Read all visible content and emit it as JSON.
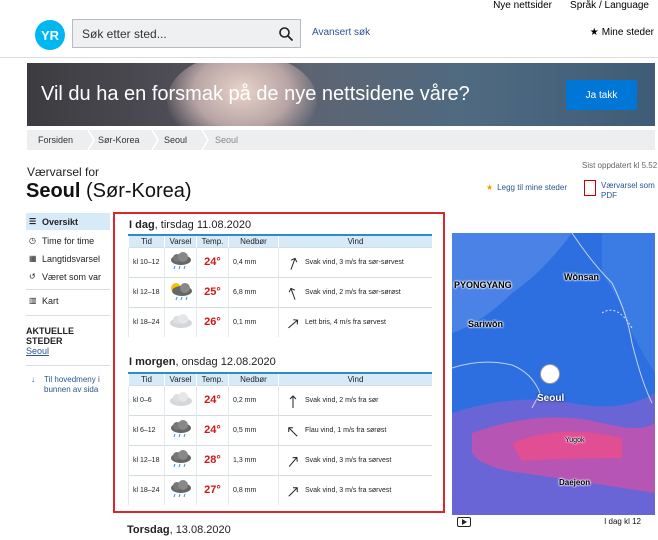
{
  "topnav": {
    "new_sites": "Nye nettsider",
    "language": "Språk / Language"
  },
  "header": {
    "logo": "YR",
    "search_placeholder": "Søk etter sted...",
    "advanced_search": "Avansert søk",
    "my_places": "Mine steder"
  },
  "banner": {
    "text": "Vil du ha en forsmak på de nye nettsidene våre?",
    "button": "Ja takk"
  },
  "breadcrumb": [
    "Forsiden",
    "Sør-Korea",
    "Seoul",
    "Seoul"
  ],
  "page": {
    "forecast_for": "Værvarsel for",
    "place": "Seoul",
    "country": "(Sør-Korea)",
    "updated": "Sist oppdatert kl 5.52",
    "add_favorite": "Legg til mine steder",
    "pdf_line1": "Værvarsel som",
    "pdf_line2": "PDF"
  },
  "sidebar": {
    "items": [
      {
        "label": "Oversikt",
        "icon": "list-icon"
      },
      {
        "label": "Time for time",
        "icon": "clock-icon"
      },
      {
        "label": "Langtidsvarsel",
        "icon": "calendar-icon"
      },
      {
        "label": "Været som var",
        "icon": "history-icon"
      },
      {
        "label": "Kart",
        "icon": "map-icon"
      }
    ],
    "current_heading": "AKTUELLE STEDER",
    "current_place": "Seoul",
    "back_to_menu_line1": "Til hovedmeny i",
    "back_to_menu_line2": "bunnen av sida"
  },
  "table_headers": {
    "time": "Tid",
    "symbol": "Varsel",
    "temp": "Temp.",
    "precip": "Nedbør",
    "wind": "Vind"
  },
  "days": [
    {
      "day": "I dag",
      "date": ", tirsdag 11.08.2020",
      "rows": [
        {
          "time": "kl 10–12",
          "icon": "rain-cloud-icon",
          "temp": "24°",
          "precip": "0,4 mm",
          "wind": "Svak vind, 3 m/s fra sør-sørvest",
          "wind_dir": 200
        },
        {
          "time": "kl 12–18",
          "icon": "sun-rain-cloud-icon",
          "temp": "25°",
          "precip": "6,8 mm",
          "wind": "Svak vind, 2 m/s fra sør-sørøst",
          "wind_dir": 160
        },
        {
          "time": "kl 18–24",
          "icon": "cloud-icon",
          "temp": "26°",
          "precip": "0,1 mm",
          "wind": "Lett bris, 4 m/s fra sørvest",
          "wind_dir": 230
        }
      ]
    },
    {
      "day": "I morgen",
      "date": ", onsdag 12.08.2020",
      "rows": [
        {
          "time": "kl 0–6",
          "icon": "cloud-icon",
          "temp": "24°",
          "precip": "0,2 mm",
          "wind": "Svak vind, 2 m/s fra sør",
          "wind_dir": 180
        },
        {
          "time": "kl 6–12",
          "icon": "rain-cloud-icon",
          "temp": "24°",
          "precip": "0,5 mm",
          "wind": "Flau vind, 1 m/s fra sørøst",
          "wind_dir": 135
        },
        {
          "time": "kl 12–18",
          "icon": "rain-cloud-icon",
          "temp": "28°",
          "precip": "1,3 mm",
          "wind": "Svak vind, 3 m/s fra sørvest",
          "wind_dir": 220
        },
        {
          "time": "kl 18–24",
          "icon": "rain-cloud-icon",
          "temp": "27°",
          "precip": "0,8 mm",
          "wind": "Svak vind, 3 m/s fra sørvest",
          "wind_dir": 225
        }
      ]
    }
  ],
  "next_day": {
    "day": "Torsdag",
    "date": ", 13.08.2020"
  },
  "map": {
    "labels": [
      "PYONGYANG",
      "Wŏnsan",
      "Sariwŏn",
      "Seoul",
      "Yugok",
      "Daejeon"
    ],
    "time": "I dag kl 12"
  }
}
